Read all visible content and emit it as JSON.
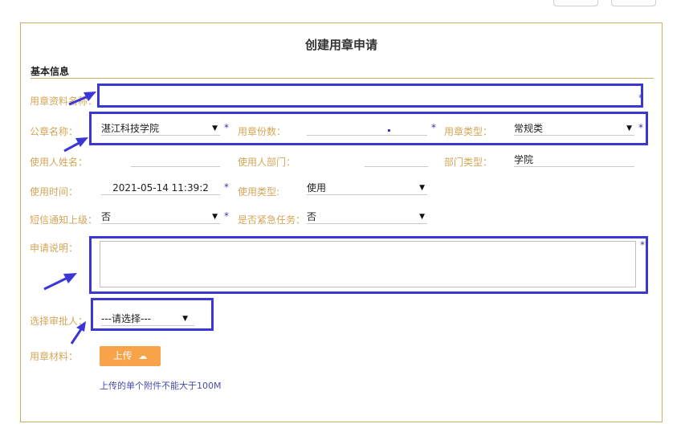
{
  "form": {
    "title": "创建用章申请",
    "section_title": "基本信息",
    "fields": {
      "material_name": {
        "label": "用章资料名称：",
        "value": ""
      },
      "seal_name": {
        "label": "公章名称：",
        "value": "湛江科技学院"
      },
      "seal_copies": {
        "label": "用章份数：",
        "value": ""
      },
      "seal_type": {
        "label": "用章类型：",
        "value": "常规类"
      },
      "user_name": {
        "label": "使用人姓名：",
        "value": ""
      },
      "user_dept": {
        "label": "使用人部门：",
        "value": ""
      },
      "dept_type": {
        "label": "部门类型：",
        "value": "学院"
      },
      "use_time": {
        "label": "使用时间：",
        "value": "2021-05-14 11:39:2"
      },
      "use_type": {
        "label": "使用类型:",
        "value": "使用"
      },
      "sms_notify": {
        "label": "短信通知上级：",
        "value": "否"
      },
      "urgent": {
        "label": "是否紧急任务：",
        "value": "否"
      },
      "description": {
        "label": "申请说明：",
        "value": ""
      },
      "approver": {
        "label": "选择审批人：",
        "value": "---请选择---"
      },
      "material": {
        "label": "用章材料："
      }
    },
    "required_mark": "*",
    "upload_label": "上传",
    "upload_icon": "cloud-upload-icon",
    "upload_note": "上传的单个附件不能大于100M"
  },
  "colors": {
    "label": "#d4a657",
    "panel_border": "#c8b069",
    "highlight": "#3b37d6",
    "upload_button": "#f6a34a"
  }
}
